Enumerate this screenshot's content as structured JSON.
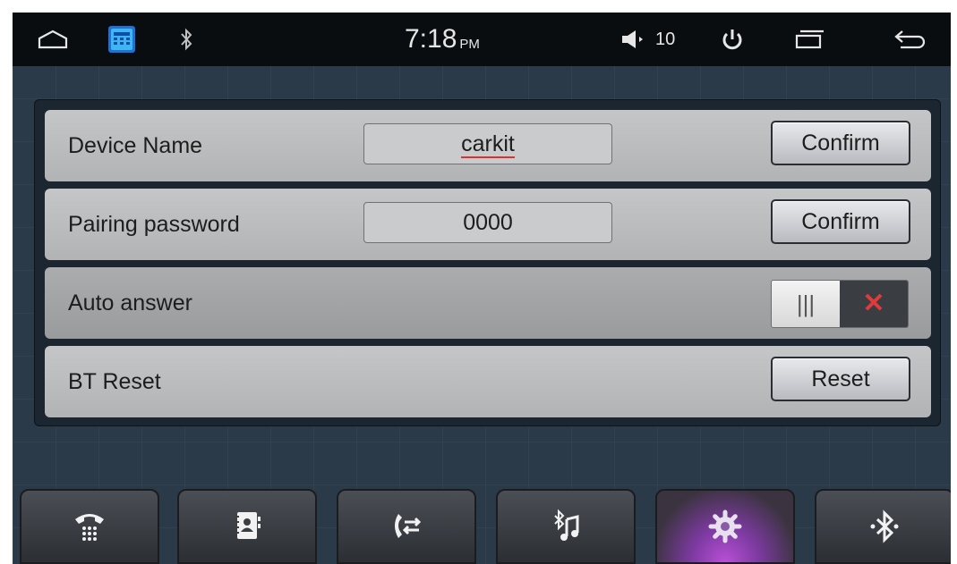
{
  "status_bar": {
    "home_icon": "home-icon",
    "app_icon": "phone-app-icon",
    "bluetooth_icon": "bluetooth-icon",
    "time": "7:18",
    "ampm": "PM",
    "volume_icon": "volume-icon",
    "volume": "10",
    "power_icon": "power-icon",
    "recent_icon": "recent-apps-icon",
    "back_icon": "back-icon"
  },
  "settings": {
    "device_name": {
      "label": "Device Name",
      "value": "carkit",
      "button": "Confirm"
    },
    "pairing_password": {
      "label": "Pairing password",
      "value": "0000",
      "button": "Confirm"
    },
    "auto_answer": {
      "label": "Auto answer",
      "toggle_off_glyph": "|||",
      "toggle_state_glyph": "✕",
      "enabled": false
    },
    "bt_reset": {
      "label": "BT Reset",
      "button": "Reset"
    }
  },
  "bottom_nav": [
    {
      "name": "dialpad",
      "icon": "dialpad-icon"
    },
    {
      "name": "contacts",
      "icon": "contacts-icon"
    },
    {
      "name": "call-log",
      "icon": "call-log-icon"
    },
    {
      "name": "bt-music",
      "icon": "bluetooth-music-icon"
    },
    {
      "name": "settings",
      "icon": "gear-icon",
      "active": true
    },
    {
      "name": "bluetooth-connect",
      "icon": "bluetooth-connect-icon"
    }
  ],
  "colors": {
    "status_bar_bg": "#0a0d10",
    "screen_bg": "#2b3a48",
    "active_tab_glow": "#b94fd6",
    "toggle_x": "#e03b3b"
  }
}
